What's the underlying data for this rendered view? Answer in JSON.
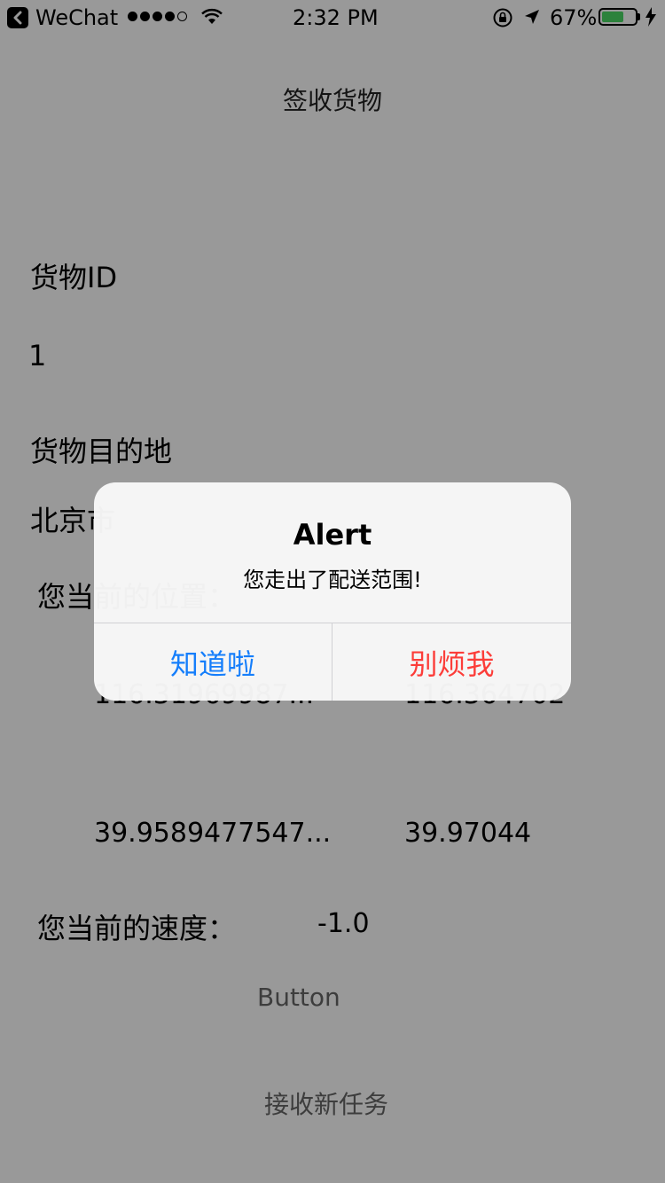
{
  "status_bar": {
    "back_app": "WeChat",
    "time": "2:32 PM",
    "battery_percent": "67%",
    "battery_level": 0.67,
    "signal_bars_filled": 4,
    "signal_bars_total": 5,
    "battery_color": "#4cd964"
  },
  "nav": {
    "title": "签收货物"
  },
  "form": {
    "goods_id_label": "货物ID",
    "goods_id_value": "1",
    "destination_label": "货物目的地",
    "destination_value": "北京市",
    "position_label": "您当前的位置：",
    "lon_current": "116.31969987...",
    "lon_target": "116.364702",
    "lat_current": "39.9589477547...",
    "lat_target": "39.97044",
    "speed_label": "您当前的速度：",
    "speed_value": "-1.0",
    "button_label": "Button",
    "new_task_label": "接收新任务"
  },
  "alert": {
    "title": "Alert",
    "message": "您走出了配送范围!",
    "ok_label": "知道啦",
    "dismiss_label": "别烦我",
    "ok_color": "#157efb",
    "dismiss_color": "#fc3d39"
  },
  "colors": {
    "dim_overlay": "rgba(0,0,0,0.40)"
  }
}
